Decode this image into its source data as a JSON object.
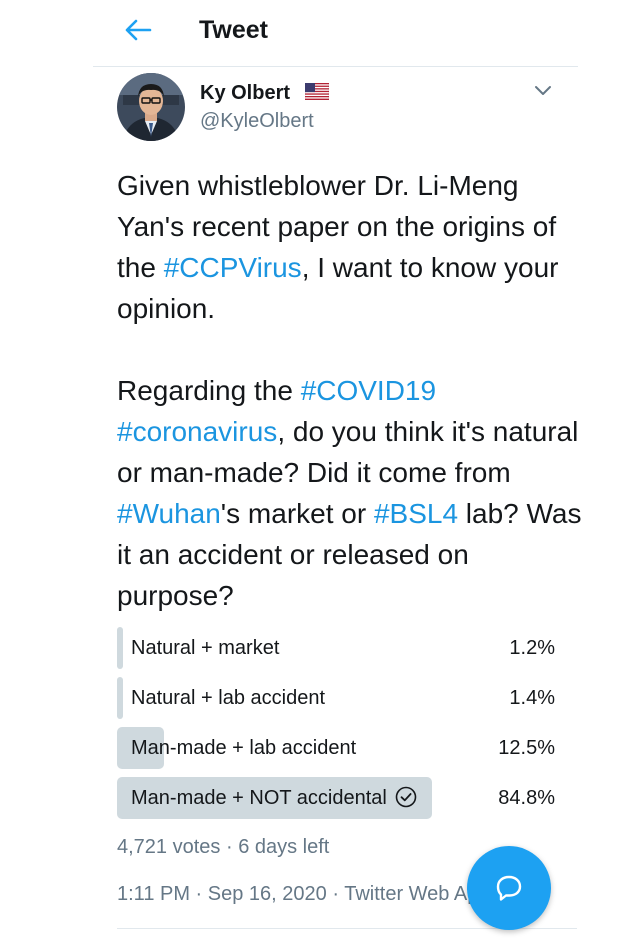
{
  "header": {
    "title": "Tweet",
    "back_icon": "arrow-left-icon",
    "accent": "#1da1f2"
  },
  "author": {
    "name": "Ky Olbert",
    "handle": "@KyleOlbert",
    "flag_icon": "us-flag-icon",
    "menu_icon": "chevron-down-icon"
  },
  "tweet": {
    "text_parts": [
      {
        "t": "Given whistleblower Dr. Li-Meng Yan's recent paper on the origins of the "
      },
      {
        "t": "#CCPVirus",
        "tag": true
      },
      {
        "t": ", I want to know your opinion.\n\nRegarding the "
      },
      {
        "t": "#COVID19",
        "tag": true
      },
      {
        "t": " "
      },
      {
        "t": "#coronavirus",
        "tag": true
      },
      {
        "t": ", do you think it's natural or man-made? Did it come from "
      },
      {
        "t": "#Wuhan",
        "tag": true
      },
      {
        "t": "'s market or "
      },
      {
        "t": "#BSL4",
        "tag": true
      },
      {
        "t": " lab? Was it an accident or released on purpose?"
      }
    ],
    "hashtag_color": "#1b95e0"
  },
  "poll": {
    "options": [
      {
        "label": "Natural + market",
        "percent": "1.2%",
        "fraction": 0.012,
        "selected": false
      },
      {
        "label": "Natural + lab accident",
        "percent": "1.4%",
        "fraction": 0.014,
        "selected": false
      },
      {
        "label": "Man-made + lab accident",
        "percent": "12.5%",
        "fraction": 0.125,
        "selected": false
      },
      {
        "label": "Man-made + NOT accidental",
        "percent": "84.8%",
        "fraction": 0.848,
        "selected": true
      }
    ],
    "votes": "4,721 votes",
    "time_left": "6 days left",
    "bar_color": "#cfd9de"
  },
  "meta": {
    "time": "1:11 PM",
    "date": "Sep 16, 2020",
    "source": "Twitter Web App"
  },
  "fab": {
    "icon": "compose-reply-icon"
  }
}
